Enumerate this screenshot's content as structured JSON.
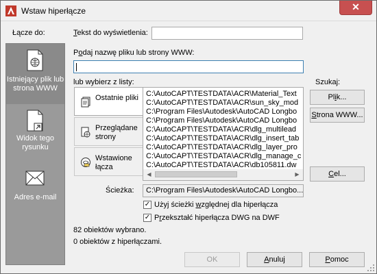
{
  "window": {
    "title": "Wstaw hiperłącze",
    "close_glyph": "✕"
  },
  "link_to": {
    "label": "Łącze do:",
    "items": [
      {
        "label": "Istniejący plik lub strona WWW",
        "icon": "document-globe-icon",
        "selected": true
      },
      {
        "label": "Widok tego rysunku",
        "icon": "document-arrow-icon",
        "selected": false
      },
      {
        "label": "Adres e-mail",
        "icon": "envelope-icon",
        "selected": false
      }
    ]
  },
  "display_text": {
    "label_prefix": "T",
    "label_rest": "ekst do wyświetlenia:",
    "value": ""
  },
  "filename": {
    "label_prefix": "P",
    "label_underlined": "o",
    "label_rest": "daj nazwę pliku lub strony WWW:",
    "value": ""
  },
  "select_from": {
    "label": "lub wybierz z listy:",
    "tabs": [
      {
        "label": "Ostatnie pliki",
        "icon": "recent-files-icon",
        "active": true
      },
      {
        "label": "Przeglądane strony",
        "icon": "browsed-pages-icon",
        "active": false
      },
      {
        "label": "Wstawione łącza",
        "icon": "inserted-links-icon",
        "active": false
      }
    ],
    "files": [
      "C:\\AutoCAPT\\TESTDATA\\ACR\\Material_Text",
      "C:\\AutoCAPT\\TESTDATA\\ACR\\sun_sky_mod",
      "C:\\Program Files\\Autodesk\\AutoCAD Longbo",
      "C:\\Program Files\\Autodesk\\AutoCAD Longbo",
      "C:\\AutoCAPT\\TESTDATA\\ACR\\dlg_multilead",
      "C:\\AutoCAPT\\TESTDATA\\ACR\\dlg_insert_tab",
      "C:\\AutoCAPT\\TESTDATA\\ACR\\dlg_layer_pro",
      "C:\\AutoCAPT\\TESTDATA\\ACR\\dlg_manage_c",
      "C:\\AutoCAPT\\TESTDATA\\ACR\\db105811.dw"
    ]
  },
  "browse": {
    "label": "Szukaj:",
    "file_button_prefix": "Pl",
    "file_button_underlined": "i",
    "file_button_rest": "k...",
    "web_button_underlined": "S",
    "web_button_rest": "trona WWW..."
  },
  "target_button": {
    "underlined": "C",
    "rest": "el..."
  },
  "path": {
    "label": "Ścieżka:",
    "value": "C:\\Program Files\\Autodesk\\AutoCAD Longbo..."
  },
  "options": {
    "relative_path": {
      "prefix": "Użyj ścieżki ",
      "underlined": "w",
      "rest": "zględnej dla hiperłącza",
      "checked": true
    },
    "convert_dwf": {
      "prefix": "P",
      "underlined": "r",
      "rest": "zekształć hiperłącza DWG na DWF",
      "checked": true
    }
  },
  "status": {
    "selected_count": "82 obiektów wybrano.",
    "with_links": "0 obiektów z hiperłączami."
  },
  "buttons": {
    "ok": "OK",
    "cancel_underlined": "A",
    "cancel_rest": "nuluj",
    "help_underlined": "P",
    "help_rest": "omoc"
  },
  "check_glyph": "✓",
  "colors": {
    "panel_bg": "#9a9a9a",
    "close_bg": "#c75050",
    "accent_border": "#3c7fb1"
  }
}
